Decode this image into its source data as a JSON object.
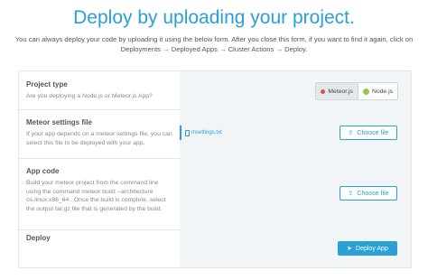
{
  "header": {
    "title": "Deploy by uploading your project.",
    "intro": "You can always deploy your code by uploading it using the below form. After you close this form, if you want to find it again, click on Deployments → Deployed Apps → Cluster Actions → Deploy."
  },
  "rows": {
    "project_type": {
      "title": "Project type",
      "description": "Are you deploying a Node.js or Meteor.js App?",
      "options": [
        {
          "label": "Meteor.js",
          "icon": "meteor-icon",
          "selected": true
        },
        {
          "label": "Node.js",
          "icon": "nodejs-icon",
          "selected": false
        }
      ]
    },
    "meteor_settings": {
      "title": "Meteor settings file",
      "description": "If your app depends on a meteor settings file, you can select this file to be deployed with your app.",
      "file_name": "msettings.txt",
      "button_label": "Choose file"
    },
    "app_code": {
      "title": "App code",
      "description": "Build your meteor project from the command line using the command meteor build --architecture os.linux.x86_64 . Once the build is complete, select the output tar.gz file that is generated by the build.",
      "button_label": "Choose file"
    },
    "deploy": {
      "title": "Deploy",
      "button_label": "Deploy App"
    }
  },
  "colors": {
    "accent": "#2a9fd8",
    "panel_right": "#f1f5f7"
  }
}
